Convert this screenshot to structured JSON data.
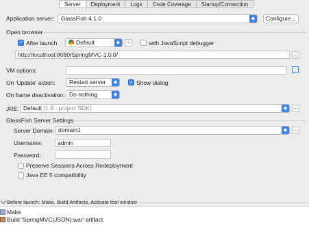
{
  "tabs": [
    "Server",
    "Deployment",
    "Logs",
    "Code Coverage",
    "Startup/Connection"
  ],
  "active_tab": "Server",
  "app_server": {
    "label": "Application server:",
    "value": "GlassFish 4.1.0",
    "configure_label": "Configure..."
  },
  "open_browser": {
    "section": "Open browser",
    "after_launch_label": "After launch",
    "after_launch_checked": true,
    "browser_value": "Default",
    "js_debugger_label": "with JavaScript debugger",
    "js_debugger_checked": false,
    "url": "http://localhost:8080/SpringMVC-1.0.0/"
  },
  "vm_options_label": "VM options:",
  "update_action": {
    "label": "On 'Update' action:",
    "value": "Restart server",
    "show_dialog_label": "Show dialog",
    "show_dialog_checked": true
  },
  "frame_deactivation": {
    "label": "On frame deactivation:",
    "value": "Do nothing"
  },
  "jre": {
    "label": "JRE:",
    "value": "Default",
    "hint": "(1.8 - project SDK)"
  },
  "glassfish": {
    "section": "GlassFish Server Settings",
    "domain_label": "Server Domain:",
    "domain_value": "domain1",
    "username_label": "Username:",
    "username_value": "admin",
    "password_label": "Password:",
    "password_value": "",
    "preserve_sessions_label": "Preserve Sessions Across Redeployment",
    "javaee5_label": "Java EE 5 compatibility"
  },
  "before_launch": {
    "header": "Before launch: Make, Build Artifacts, Activate tool window",
    "items": [
      "Make",
      "Build 'SpringMVC(JSON):war' artifact"
    ]
  }
}
